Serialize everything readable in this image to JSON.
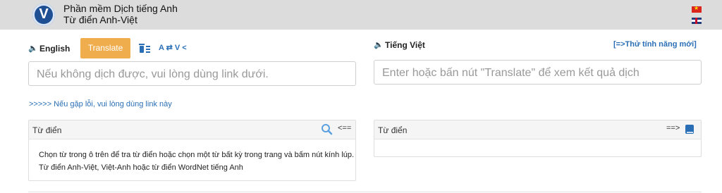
{
  "header": {
    "logo_letter": "V",
    "title": "Phần mềm Dịch tiếng Anh",
    "subtitle": "Từ điển Anh-Việt"
  },
  "toolbar": {
    "source_language": "English",
    "translate_label": "Translate",
    "swap_label": "A ⇄ V <",
    "target_language": "Tiếng Việt",
    "try_new_link": "[=>Thử tính năng mới]"
  },
  "inputs": {
    "source_placeholder": "Nếu không dịch được, vui lòng dùng link dưới.",
    "target_placeholder": "Enter hoặc bấn nút \"Translate\" để xem kết quả dịch"
  },
  "hint_link": ">>>>> Nếu gặp lỗi, vui lòng dùng link này",
  "dictionary_left": {
    "title": "Từ điển",
    "arrow": "<==",
    "body": "Chọn từ trong ô trên để tra từ điển hoặc chọn một từ bất kỳ trong trang và bấm nút kính lúp. Từ điển Anh-Việt, Việt-Anh hoặc từ điển WordNet tiếng Anh"
  },
  "dictionary_right": {
    "title": "Từ điển",
    "arrow": "==>"
  },
  "colors": {
    "header_bg": "#dcdcdc",
    "translate_button": "#f0ad4e",
    "link_blue": "#2a6fb6"
  }
}
